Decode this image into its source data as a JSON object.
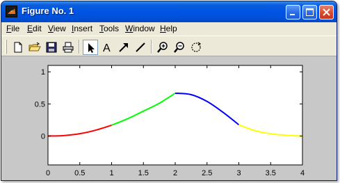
{
  "window": {
    "title": "Figure No. 1"
  },
  "menu": {
    "items": [
      {
        "mnemonic": "F",
        "rest": "ile"
      },
      {
        "mnemonic": "E",
        "rest": "dit"
      },
      {
        "mnemonic": "V",
        "rest": "iew"
      },
      {
        "mnemonic": "I",
        "rest": "nsert"
      },
      {
        "mnemonic": "T",
        "rest": "ools"
      },
      {
        "mnemonic": "W",
        "rest": "indow"
      },
      {
        "mnemonic": "H",
        "rest": "elp"
      }
    ]
  },
  "toolbar": {
    "tools": [
      "new-file-icon",
      "open-folder-icon",
      "save-icon",
      "print-icon",
      "select-arrow-icon",
      "text-insert-icon",
      "arrow-insert-icon",
      "line-insert-icon",
      "zoom-in-icon",
      "zoom-out-icon",
      "rotate-3d-icon"
    ],
    "text_tool_label": "A"
  },
  "chart_data": {
    "type": "line",
    "title": "",
    "xlabel": "",
    "ylabel": "",
    "xlim": [
      0,
      4
    ],
    "ylim": [
      -0.45,
      1.1
    ],
    "x_ticks": [
      "0",
      "0.5",
      "1",
      "1.5",
      "2",
      "2.5",
      "3",
      "3.5",
      "4"
    ],
    "y_ticks": [
      "0",
      "0.5",
      "1"
    ],
    "grid": false,
    "series": [
      {
        "color": "#ff0000",
        "x": [
          0,
          0.25,
          0.5,
          0.75,
          1.0
        ],
        "y": [
          0.0,
          0.007,
          0.036,
          0.091,
          0.168
        ]
      },
      {
        "color": "#00ff00",
        "x": [
          1.0,
          1.25,
          1.5,
          1.75,
          2.0
        ],
        "y": [
          0.168,
          0.269,
          0.388,
          0.51,
          0.667
        ]
      },
      {
        "color": "#0000ff",
        "x": [
          2.0,
          2.25,
          2.5,
          2.75,
          3.0
        ],
        "y": [
          0.667,
          0.645,
          0.539,
          0.37,
          0.175
        ]
      },
      {
        "color": "#ffff00",
        "x": [
          3.0,
          3.25,
          3.5,
          3.75,
          4.0
        ],
        "y": [
          0.175,
          0.085,
          0.035,
          0.01,
          0.0
        ]
      }
    ]
  }
}
